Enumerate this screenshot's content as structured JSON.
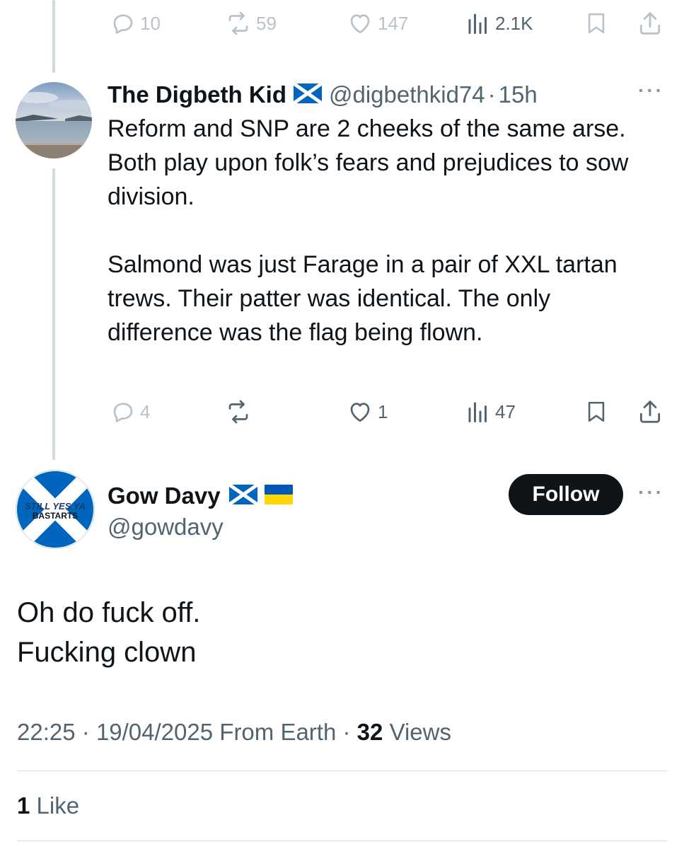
{
  "prev_tweet": {
    "actions": {
      "replies": "10",
      "reposts": "59",
      "likes": "147",
      "views": "2.1K"
    }
  },
  "reply_tweet": {
    "name": "The Digbeth Kid",
    "flag_icon": "scotland-flag-icon",
    "handle": "@digbethkid74",
    "separator": "·",
    "time": "15h",
    "text": {
      "line1": "Reform and SNP are 2 cheeks of the same arse.",
      "line2": "Both play upon folk’s fears and prejudices to sow division.",
      "line3": "Salmond was just Farage in a pair of XXL tartan trews. Their patter was identical. The only difference was the flag being flown."
    },
    "actions": {
      "replies": "4",
      "likes": "1",
      "views": "47"
    }
  },
  "main_tweet": {
    "name": "Gow Davy",
    "flag_icons": [
      "scotland-flag-icon",
      "ukraine-flag-icon"
    ],
    "handle": "@gowdavy",
    "follow_label": "Follow",
    "avatar_text_line1": "STILL YES YA",
    "avatar_text_line2": "BASTARTS",
    "text": {
      "line1": "Oh do fuck off.",
      "line2": "Fucking clown"
    },
    "time": "22:25",
    "sep1": "·",
    "date": "19/04/2025",
    "source": "From Earth",
    "sep2": "·",
    "views_count": "32",
    "views_label": "Views",
    "likes_count": "1",
    "likes_label": "Like"
  },
  "colors": {
    "text_primary": "#0f1419",
    "text_secondary": "#536471",
    "thread_line": "#cfd9de",
    "saltire_blue": "#0065bd",
    "ukraine_blue": "#0057b7",
    "ukraine_yellow": "#ffd700"
  }
}
